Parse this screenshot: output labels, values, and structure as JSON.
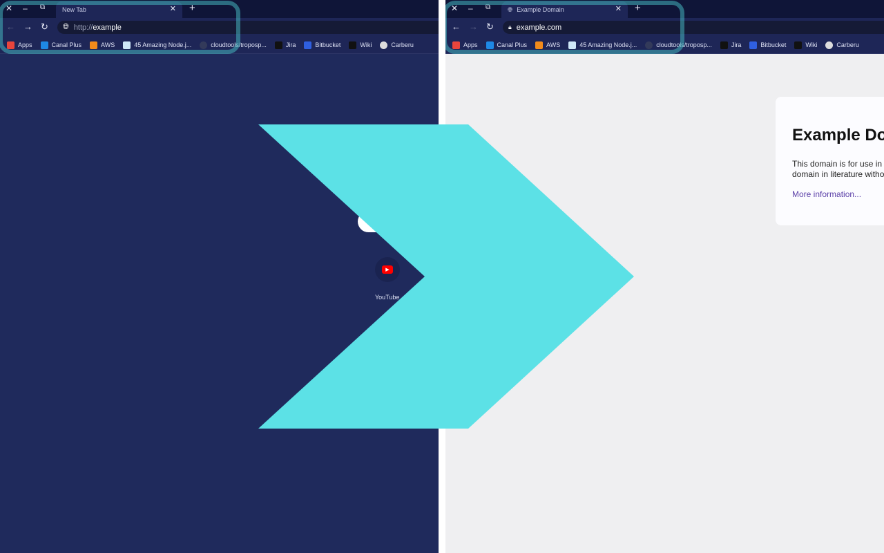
{
  "left": {
    "tab_title": "New Tab",
    "url_scheme": "http://",
    "url_host": "example",
    "shortcut_label": "YouTube"
  },
  "right": {
    "tab_title": "Example Domain",
    "url": "example.com",
    "heading": "Example Domain",
    "body_line1": "This domain is for use in illustrative examples in documents. You may use this",
    "body_line2": "domain in literature without prior coordination or asking for permission.",
    "link": "More information..."
  },
  "bookmarks": [
    {
      "label": "Apps",
      "color": "#e8453c"
    },
    {
      "label": "Canal Plus",
      "color": "#1e88e5"
    },
    {
      "label": "AWS",
      "color": "#f28b1b"
    },
    {
      "label": "45 Amazing Node.j...",
      "color": "#cfe8f7"
    },
    {
      "label": "cloudtools/troposp...",
      "color": "#333a5a"
    },
    {
      "label": "Jira",
      "color": "#111"
    },
    {
      "label": "Bitbucket",
      "color": "#2f5fe0"
    },
    {
      "label": "Wiki",
      "color": "#111"
    },
    {
      "label": "Carberu",
      "color": "#ddd"
    }
  ],
  "colors": {
    "chevron": "#5ce1e6",
    "left_bg": "#1f2a5c",
    "right_bg": "#efeff1"
  }
}
